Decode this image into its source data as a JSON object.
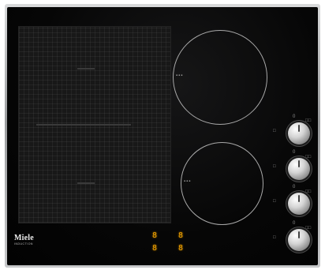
{
  "appliance": {
    "brand": "Miele",
    "line": "INDUCTION",
    "flex_zone_name": "flex-inductor",
    "cooking_zones": [
      "rear-right-zone",
      "front-right-zone"
    ]
  },
  "displays": [
    {
      "id": "display-top-left",
      "value": "8"
    },
    {
      "id": "display-top-right",
      "value": "8"
    },
    {
      "id": "display-bottom-left",
      "value": "8"
    },
    {
      "id": "display-bottom-right",
      "value": "8"
    }
  ],
  "knobs": [
    {
      "id": "knob-1",
      "marks": [
        "0",
        "□□",
        "□"
      ]
    },
    {
      "id": "knob-2",
      "marks": [
        "0",
        "□□",
        "□"
      ]
    },
    {
      "id": "knob-3",
      "marks": [
        "0",
        "□□",
        "□"
      ]
    },
    {
      "id": "knob-4",
      "marks": [
        "0",
        "□□",
        "□"
      ]
    }
  ],
  "colors": {
    "glass": "#050505",
    "frame": "#b9babc",
    "display": "#f2a300",
    "ring": "#a9a9a9"
  }
}
